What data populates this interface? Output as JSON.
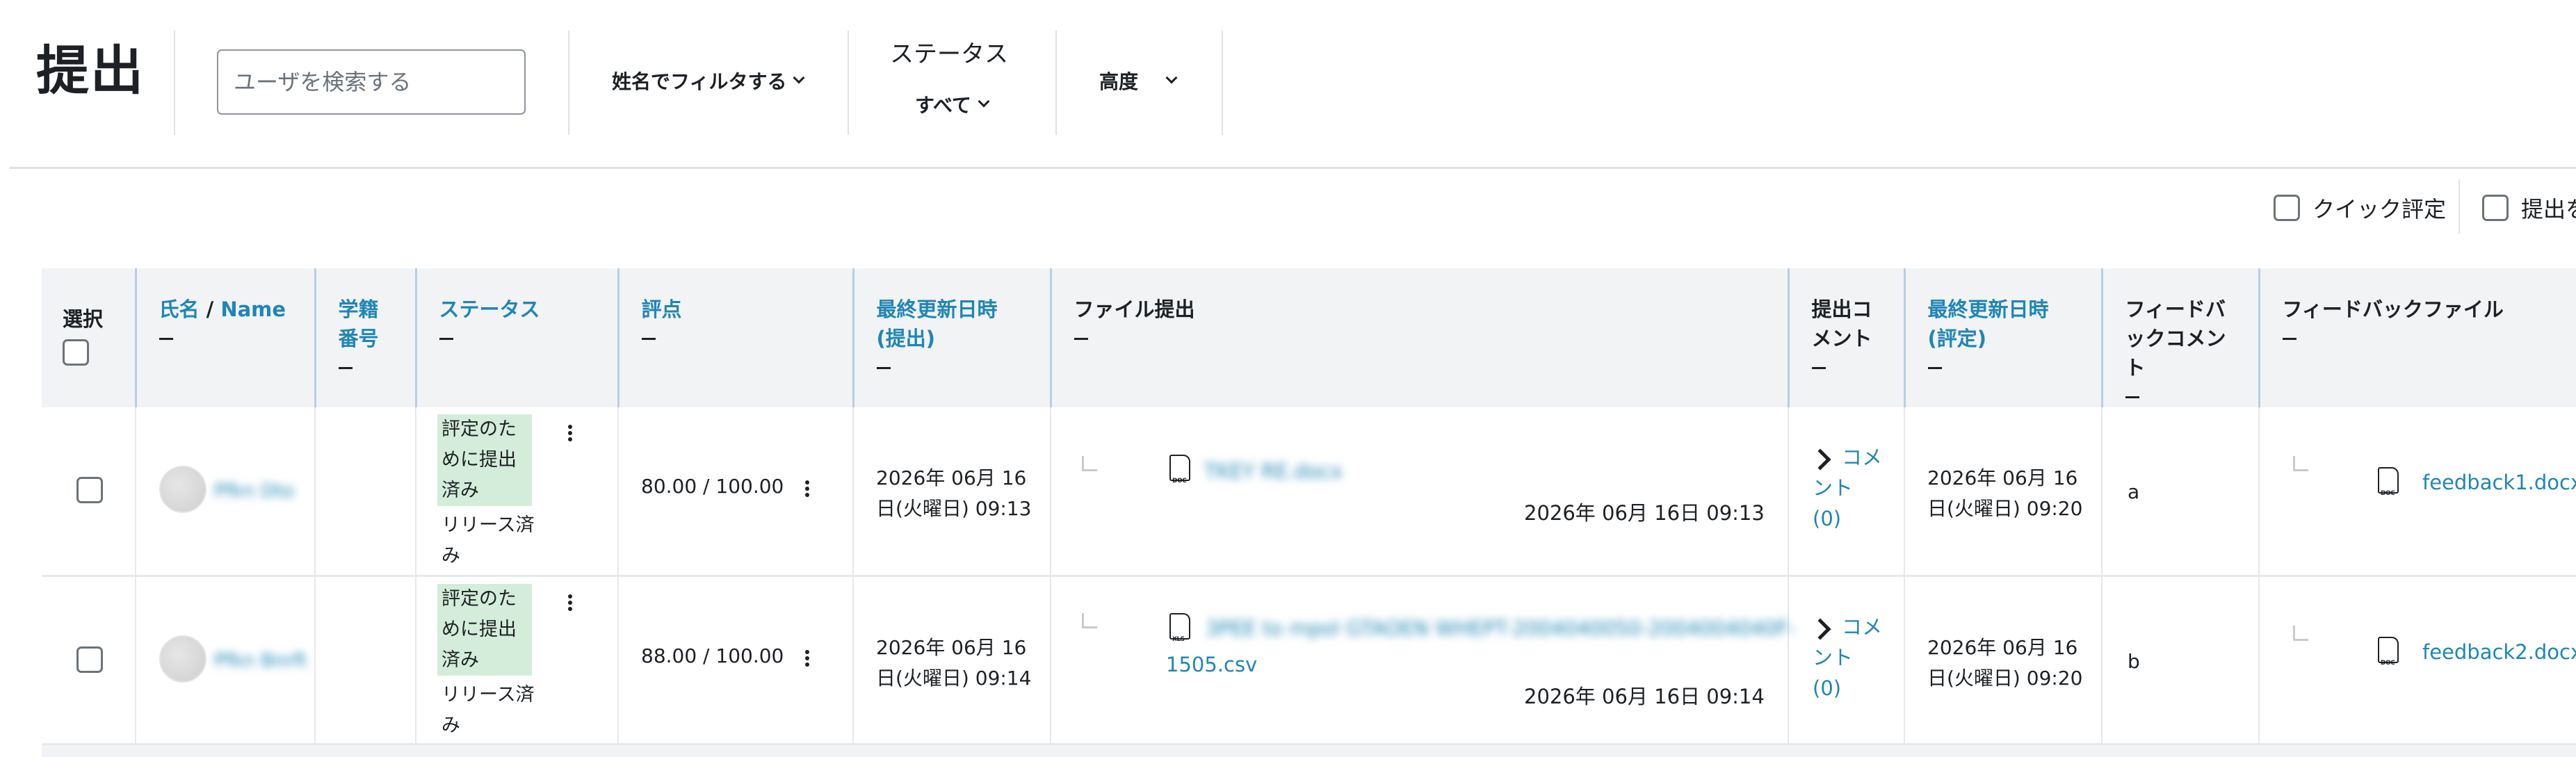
{
  "page": {
    "title": "提出"
  },
  "toolbar": {
    "search_placeholder": "ユーザを検索する",
    "filter_by_name": "姓名でフィルタする",
    "status_label": "ステータス",
    "status_value": "すべて",
    "advanced": "高度"
  },
  "options": {
    "quick_grading": "クイック評定",
    "show_only_submissions": "提出を"
  },
  "table": {
    "headers": {
      "select": "選択",
      "name_1": "氏名",
      "name_sep": " / ",
      "name_2": "Name",
      "id_number": "学籍番号",
      "status": "ステータス",
      "grade": "評点",
      "last_modified_submission": "最終更新日時 (提出)",
      "file_submissions": "ファイル提出",
      "submission_comments": "提出コメント",
      "last_modified_grade": "最終更新日時 (評定)",
      "feedback_comments": "フィードバックコメント",
      "feedback_files": "フィードバックファイル"
    },
    "rows": [
      {
        "name": "Pfkn Dto",
        "status": "評定のために提出済み",
        "release": "リリース済み",
        "grade": "80.00 / 100.00",
        "submitted_at": "2026年 06月 16日(火曜日) 09:13",
        "file_name": "TKEY RE.docx",
        "file_name_cont": "",
        "file_icon": "DOC",
        "file_date": "2026年 06月 16日 09:13",
        "comments": "コメント (0)",
        "graded_at": "2026年 06月 16日(火曜日) 09:20",
        "feedback_comment": "a",
        "feedback_file_icon": "DOC",
        "feedback_file": "feedback1.docx"
      },
      {
        "name": "Pfkn Bnrft",
        "status": "評定のために提出済み",
        "release": "リリース済み",
        "grade": "88.00 / 100.00",
        "submitted_at": "2026年 06月 16日(火曜日) 09:14",
        "file_name": "3PEE to mpol GTAOEN WHEPT-2004040050-2004004040F-",
        "file_name_cont": "1505.csv",
        "file_icon": "XLS",
        "file_date": "2026年 06月 16日 09:14",
        "comments": "コメント (0)",
        "graded_at": "2026年 06月 16日(火曜日) 09:20",
        "feedback_comment": "b",
        "feedback_file_icon": "DOC",
        "feedback_file": "feedback2.docx"
      }
    ]
  },
  "colors": {
    "link": "#1f86b5",
    "status_badge": "#d4edda",
    "header_bg": "#f2f3f5",
    "text": "#1d2125"
  }
}
